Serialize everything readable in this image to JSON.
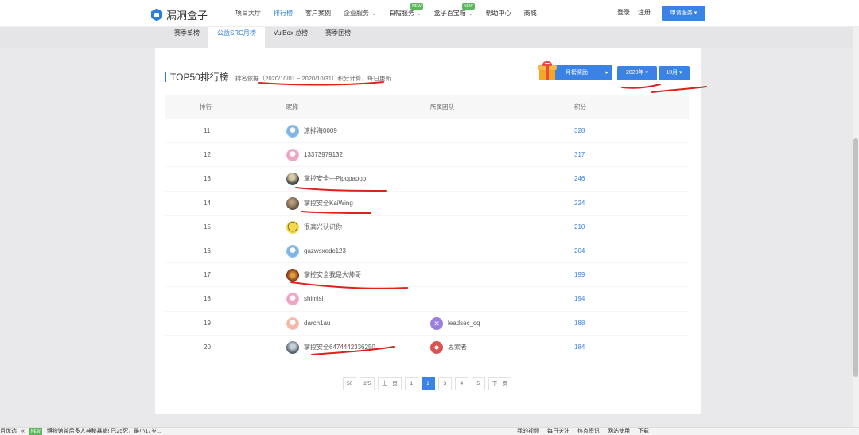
{
  "brand": {
    "logo_text": "漏洞盒子"
  },
  "nav": {
    "items": [
      {
        "label": "项目大厅",
        "active": false,
        "caret": false,
        "badge": ""
      },
      {
        "label": "排行榜",
        "active": true,
        "caret": false,
        "badge": ""
      },
      {
        "label": "客户案例",
        "active": false,
        "caret": false,
        "badge": ""
      },
      {
        "label": "企业服务",
        "active": false,
        "caret": true,
        "badge": ""
      },
      {
        "label": "白帽服务",
        "active": false,
        "caret": true,
        "badge": "NEW"
      },
      {
        "label": "盒子百宝箱",
        "active": false,
        "caret": true,
        "badge": "NEW"
      },
      {
        "label": "帮助中心",
        "active": false,
        "caret": false,
        "badge": ""
      },
      {
        "label": "商城",
        "active": false,
        "caret": false,
        "badge": ""
      }
    ],
    "login": "登录",
    "register": "注册",
    "apply_button": "申请服务 ▾"
  },
  "tabs": [
    {
      "label": "赛季单榜",
      "active": false
    },
    {
      "label": "公益SRC月榜",
      "active": true
    },
    {
      "label": "VulBox 总榜",
      "active": false
    },
    {
      "label": "赛季团榜",
      "active": false
    }
  ],
  "board": {
    "title": "TOP50排行榜",
    "basis": "排名依据（2020/10/01 ~ 2020/10/31）积分计算，每日更新",
    "month_reward": "月榜奖励",
    "year_select": "2020年 ▾",
    "month_select": "10月 ▾"
  },
  "table": {
    "headers": {
      "rank": "排行",
      "nickname": "昵称",
      "team": "所属团队",
      "score": "积分"
    },
    "rows": [
      {
        "rank": "11",
        "name": "凉拌海0009",
        "avatar": "av-blue",
        "team": "",
        "team_avatar": "",
        "score": "328"
      },
      {
        "rank": "12",
        "name": "13373979132",
        "avatar": "av-pink",
        "team": "",
        "team_avatar": "",
        "score": "317"
      },
      {
        "rank": "13",
        "name": "掌控安全—Pipopapoo",
        "avatar": "av-dark",
        "team": "",
        "team_avatar": "",
        "score": "246"
      },
      {
        "rank": "14",
        "name": "掌控安全KaiWing",
        "avatar": "av-brown",
        "team": "",
        "team_avatar": "",
        "score": "224"
      },
      {
        "rank": "15",
        "name": "很高兴认识你",
        "avatar": "av-yellow",
        "team": "",
        "team_avatar": "",
        "score": "210"
      },
      {
        "rank": "16",
        "name": "qazwsxedc123",
        "avatar": "av-blue",
        "team": "",
        "team_avatar": "",
        "score": "204"
      },
      {
        "rank": "17",
        "name": "掌控安全我是大帅哥",
        "avatar": "av-fire",
        "team": "",
        "team_avatar": "",
        "score": "199"
      },
      {
        "rank": "18",
        "name": "shimisi",
        "avatar": "av-pink",
        "team": "",
        "team_avatar": "",
        "score": "194"
      },
      {
        "rank": "19",
        "name": "darch1au",
        "avatar": "av-peach",
        "team": "leadsec_cq",
        "team_avatar": "av-purple",
        "score": "188"
      },
      {
        "rank": "20",
        "name": "掌控安全6474442336250",
        "avatar": "av-slate",
        "team": "思索者",
        "team_avatar": "av-red",
        "score": "184"
      }
    ]
  },
  "pagination": {
    "items": [
      {
        "label": "50",
        "active": false
      },
      {
        "label": "2/5",
        "active": false
      },
      {
        "label": "上一页",
        "active": false
      },
      {
        "label": "1",
        "active": false
      },
      {
        "label": "2",
        "active": true
      },
      {
        "label": "3",
        "active": false
      },
      {
        "label": "4",
        "active": false
      },
      {
        "label": "5",
        "active": false
      },
      {
        "label": "下一页",
        "active": false
      }
    ]
  },
  "statusbar": {
    "left_items": [
      "月优选",
      "«",
      "NEW",
      "博物馆茶后多人神秘暴毙! 已25死，最小17岁..."
    ],
    "right_items": [
      "我的视频",
      "每日关注",
      "热点资讯",
      "网站使用",
      "下载"
    ]
  },
  "colors": {
    "accent": "#3a82e4",
    "annotation": "#e0201b"
  }
}
